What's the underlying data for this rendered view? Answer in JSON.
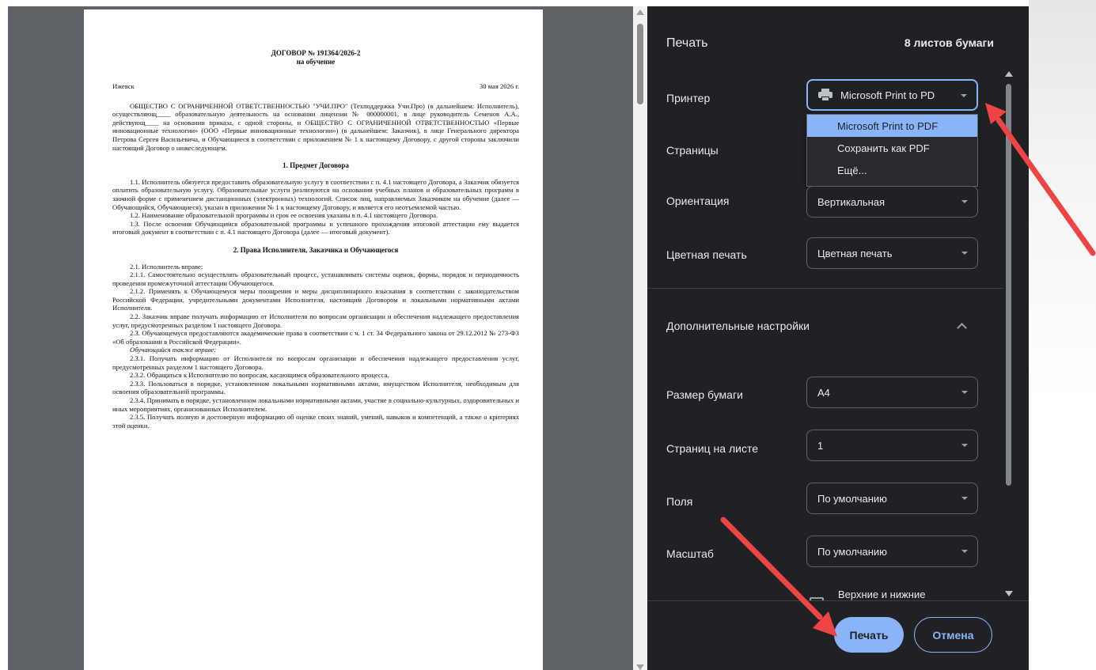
{
  "document": {
    "title": "ДОГОВОР № 191364/2026-2",
    "subtitle": "на обучение",
    "city": "Ижевск",
    "date": "30 мая 2026 г.",
    "intro": "ОБЩЕСТВО С ОГРАНИЧЕННОЙ ОТВЕТСТВЕННОСТЬЮ \"УЧИ.ПРО\" (Техподдержка Учи.Про) (в дальнейшем: Исполнитель), осуществляющ____ образовательную деятельность на основании лицензии № 000000001, в лице руководитель Семенов А.А., действующ____ на основании приказа, с одной стороны, и ОБЩЕСТВО С ОГРАНИЧЕННОЙ ОТВЕТСТВЕННОСТЬЮ «Первые инновационные технологии» (ООО «Первые инновационные технологии») (в дальнейшем: Заказчик), в лице Генерального директора Петрова Сергея Васильевича, и Обучающиеся в соответствии с приложением № 1 к настоящему Договору, с другой стороны заключили настоящий Договор о нижеследующем.",
    "section1": "1. Предмет Договора",
    "p1_1": "1.1. Исполнитель обязуется предоставить образовательную услугу в соответствии с п. 4.1 настоящего Договора, а Заказчик обязуется оплатить образовательную услугу. Образовательные услуги реализуются на основании учебных планов и образовательных программ в заочной форме с применением дистанционных (электронных) технологий. Список лиц, направляемых Заказчиком на обучение (далее — Обучающийся, Обучающиеся), указан в приложении № 1 к настоящему Договору, и является его неотъемлемой частью.",
    "p1_2": "1.2. Наименование образовательной программы и срок ее освоения указаны в п. 4.1 настоящего Договора.",
    "p1_3": "1.3. После освоения Обучающимся образовательной программы и успешного прохождения итоговой аттестации ему выдается итоговый документ в соответствии с п. 4.1 настоящего Договора (далее — итоговый документ).",
    "section2": "2. Права Исполнителя, Заказчика и Обучающегося",
    "p2_1": "2.1. Исполнитель вправе:",
    "p2_1_1": "2.1.1. Самостоятельно осуществлять образовательный процесс, устанавливать системы оценок, формы, порядок и периодичность проведения промежуточной аттестации Обучающегося.",
    "p2_1_2": "2.1.2. Применять к Обучающемуся меры поощрения и меры дисциплинарного взыскания в соответствии с законодательством Российской Федерации, учредительными документами Исполнителя, настоящим Договором и локальными нормативными актами Исполнителя.",
    "p2_2": "2.2. Заказчик вправе получать информацию от Исполнителя по вопросам организации и обеспечения надлежащего предоставления услуг, предусмотренных разделом 1 настоящего Договора.",
    "p2_3": "2.3. Обучающемуся предоставляются академические права в соответствии с ч. 1 ст. 34 Федерального закона от 29.12.2012 № 273-ФЗ «Об образовании в Российской Федерации».",
    "p2_also": "Обучающийся также вправе:",
    "p2_3_1": "2.3.1. Получать информацию от Исполнителя по вопросам организации и обеспечения надлежащего предоставления услуг, предусмотренных разделом 1 настоящего Договора.",
    "p2_3_2": "2.3.2. Обращаться к Исполнителю по вопросам, касающимся образовательного процесса.",
    "p2_3_3": "2.3.3. Пользоваться в порядке, установленном локальными нормативными актами, имуществом Исполнителя, необходимым для освоения образовательной программы.",
    "p2_3_4": "2.3.4. Принимать в порядке, установленном локальными нормативными актами, участие в социально-культурных, оздоровительных и иных мероприятиях, организованных Исполнителем.",
    "p2_3_5": "2.3.5. Получать полную и достоверную информацию об оценке своих знаний, умений, навыков и компетенций, а также о критериях этой оценки."
  },
  "print_dialog": {
    "title": "Печать",
    "sheets": "8 листов бумаги",
    "printer": {
      "label": "Принтер",
      "value": "Microsoft Print to PD"
    },
    "printer_options": [
      "Microsoft Print to PDF",
      "Сохранить как PDF",
      "Ещё..."
    ],
    "pages": {
      "label": "Страницы"
    },
    "orientation": {
      "label": "Ориентация",
      "value": "Вертикальная"
    },
    "color": {
      "label": "Цветная печать",
      "value": "Цветная печать"
    },
    "advanced": {
      "label": "Дополнительные настройки"
    },
    "paper_size": {
      "label": "Размер бумаги",
      "value": "A4"
    },
    "pages_per_sheet": {
      "label": "Страниц на листе",
      "value": "1"
    },
    "margins": {
      "label": "Поля",
      "value": "По умолчанию"
    },
    "scale": {
      "label": "Масштаб",
      "value": "По умолчанию"
    },
    "headers_footers": {
      "label": "Верхние и нижние"
    },
    "print_button": "Печать",
    "cancel_button": "Отмена"
  },
  "colors": {
    "panel_bg": "#202124",
    "accent": "#8ab4f8",
    "annotation_arrow": "#ee4444"
  }
}
